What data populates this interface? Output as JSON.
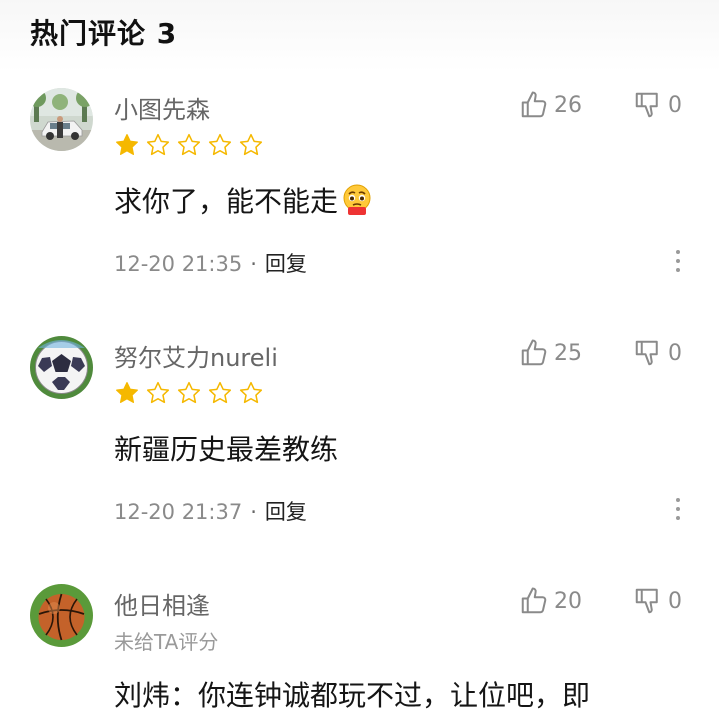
{
  "section": {
    "title": "热门评论 3"
  },
  "comments": [
    {
      "username": "小图先森",
      "rating": 1,
      "rating_max": 5,
      "text": "求你了，能不能走",
      "emoji": "pleading-face-emoji",
      "time": "12-20 21:35",
      "reply_label": "回复",
      "likes": "26",
      "dislikes": "0"
    },
    {
      "username": "努尔艾力nureli",
      "rating": 1,
      "rating_max": 5,
      "text": "新疆历史最差教练",
      "time": "12-20 21:37",
      "reply_label": "回复",
      "likes": "25",
      "dislikes": "0"
    },
    {
      "username": "他日相逢",
      "rating_text": "未给TA评分",
      "text": "刘炜：你连钟诚都玩不过，让位吧，即",
      "likes": "20",
      "dislikes": "0"
    }
  ],
  "icons": {
    "like": "thumb-up-icon",
    "dislike": "thumb-down-icon",
    "more": "more-vertical-icon",
    "star_filled": "star-filled-icon",
    "star_empty": "star-outline-icon"
  },
  "colors": {
    "star": "#f5b800",
    "username": "#666666",
    "meta": "#8a8a8a",
    "icon": "#8a8a8a"
  }
}
